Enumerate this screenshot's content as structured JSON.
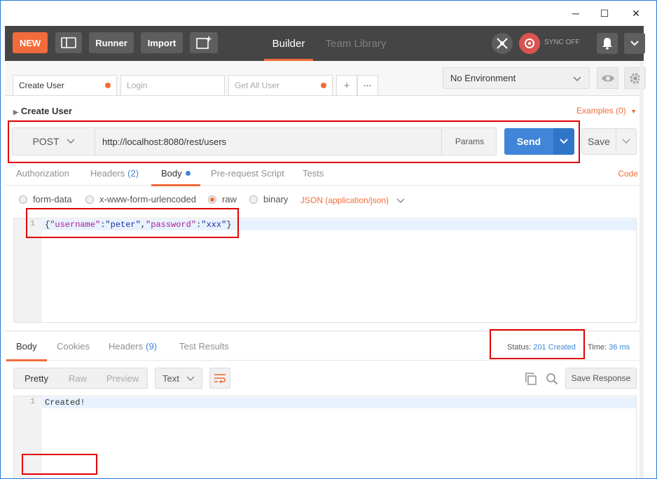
{
  "titlebar": {
    "minimize": "─",
    "maximize": "☐",
    "close": "✕"
  },
  "header": {
    "new_label": "NEW",
    "runner_label": "Runner",
    "import_label": "Import",
    "tabs": [
      {
        "label": "Builder"
      },
      {
        "label": "Team Library"
      }
    ],
    "sync_label": "SYNC OFF"
  },
  "request_tabs": [
    {
      "label": "Create User",
      "unsaved": true
    },
    {
      "label": "Login",
      "unsaved": false
    },
    {
      "label": "Get All User",
      "unsaved": true
    }
  ],
  "add_tab": "+",
  "more_tab": "•••",
  "environment": {
    "selected": "No Environment"
  },
  "request": {
    "title": "Create User",
    "examples_label": "Examples (0)",
    "method": "POST",
    "url": "http://localhost:8080/rest/users",
    "params_label": "Params",
    "send_label": "Send",
    "save_label": "Save",
    "tabs": [
      {
        "label": "Authorization"
      },
      {
        "label": "Headers",
        "count": "(2)"
      },
      {
        "label": "Body"
      },
      {
        "label": "Pre-request Script"
      },
      {
        "label": "Tests"
      }
    ],
    "code_label": "Code",
    "body_modes": [
      {
        "label": "form-data"
      },
      {
        "label": "x-www-form-urlencoded"
      },
      {
        "label": "raw"
      },
      {
        "label": "binary"
      }
    ],
    "content_type": "JSON (application/json)",
    "body_line_number": "1",
    "body_tokens": {
      "open": "{",
      "k1": "\"username\"",
      "c1": ":",
      "v1": "\"peter\"",
      "comma": ",",
      "k2": "\"password\"",
      "c2": ":",
      "v2": "\"xxx\"",
      "close": "}"
    }
  },
  "response": {
    "tabs": [
      {
        "label": "Body"
      },
      {
        "label": "Cookies"
      },
      {
        "label": "Headers",
        "count": "(9)"
      },
      {
        "label": "Test Results"
      }
    ],
    "status_label": "Status:",
    "status_value": "201 Created",
    "time_label": "Time:",
    "time_value": "36 ms",
    "view_modes": [
      {
        "label": "Pretty"
      },
      {
        "label": "Raw"
      },
      {
        "label": "Preview"
      }
    ],
    "format": "Text",
    "save_label": "Save Response",
    "line_number": "1",
    "body": "Created!"
  },
  "colors": {
    "accent": "#f26b3a",
    "primary": "#3f86d8",
    "header_bg": "#454545",
    "annotation": "#e00000"
  }
}
